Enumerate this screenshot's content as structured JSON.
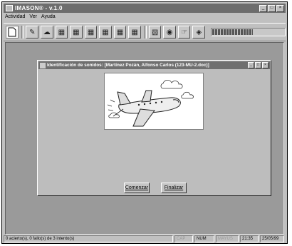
{
  "app": {
    "title": "IMASON® - v.1.0"
  },
  "menu": {
    "items": [
      "Actividad",
      "Ver",
      "Ayuda"
    ]
  },
  "toolbar": {
    "progress_value": 0.55
  },
  "dialog": {
    "title": "Identificación de sonidos: [Martínez Pozán, Alfonso Carlos (123-MU-2.doc)]",
    "start_button": "Comenzar",
    "finish_button": "Finalizar"
  },
  "status": {
    "message": "0 acierto(s), 0 fallo(s) de 3 intento(s)",
    "cap": "CAP",
    "num": "NUM",
    "mayus": "MAYUS",
    "time": "21:35",
    "date": "25/05/99"
  }
}
